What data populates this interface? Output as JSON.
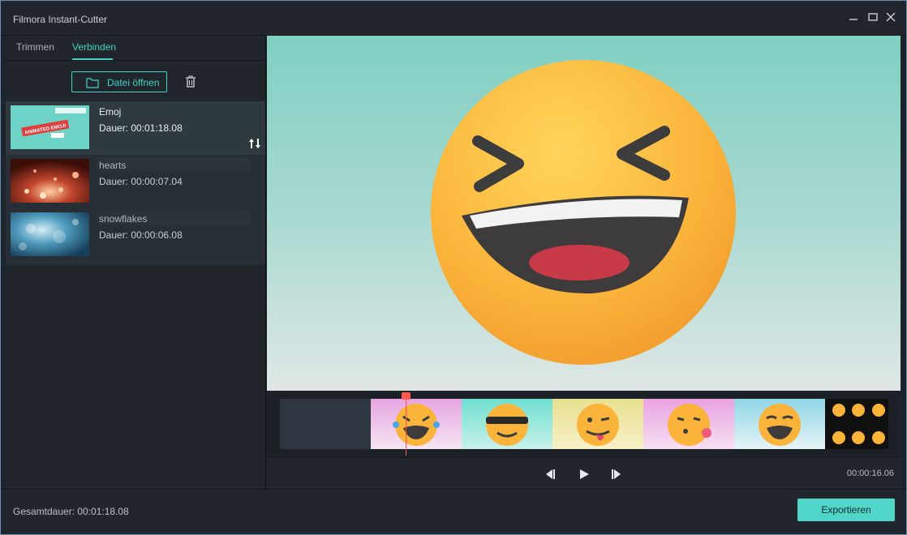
{
  "window": {
    "title": "Filmora Instant-Cutter"
  },
  "tabs": [
    {
      "label": "Trimmen"
    },
    {
      "label": "Verbinden"
    }
  ],
  "toolbar": {
    "open_label": "Datei öffnen"
  },
  "clips": [
    {
      "name": "Emoj",
      "duration": "Dauer: 00:01:18.08",
      "thumb_label": "ANIMATED EMOJI",
      "selected": true
    },
    {
      "name": "hearts",
      "duration": "Dauer: 00:00:07.04",
      "selected": false
    },
    {
      "name": "snowflakes",
      "duration": "Dauer: 00:00:06.08",
      "selected": false
    }
  ],
  "player": {
    "time": "00:00:16.06"
  },
  "footer": {
    "total": "Gesamtdauer: 00:01:18.08",
    "export_label": "Exportieren"
  },
  "colors": {
    "accent": "#44d2c5",
    "export_bg": "#4fd6c9",
    "playhead": "#ff5a4d"
  }
}
